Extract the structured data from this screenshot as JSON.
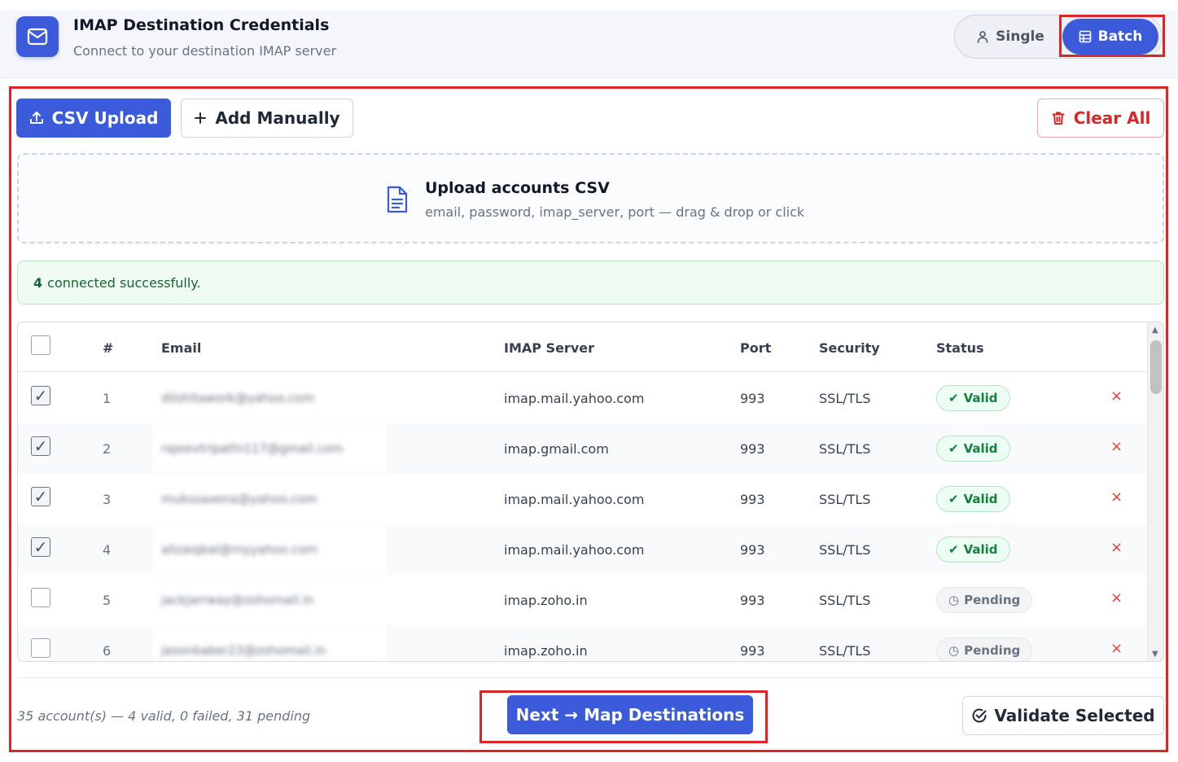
{
  "header": {
    "title": "IMAP Destination Credentials",
    "subtitle": "Connect to your destination IMAP server",
    "mode_single": "Single",
    "mode_batch": "Batch"
  },
  "toolbar": {
    "csv_upload": "CSV Upload",
    "add_manually": "Add Manually",
    "clear_all": "Clear All"
  },
  "dropzone": {
    "title": "Upload accounts CSV",
    "subtitle": "email, password, imap_server, port — drag & drop or click"
  },
  "success": {
    "count": "4",
    "message": "connected successfully."
  },
  "table": {
    "headers": {
      "num": "#",
      "email": "Email",
      "server": "IMAP Server",
      "port": "Port",
      "security": "Security",
      "status": "Status"
    },
    "rows": [
      {
        "num": "1",
        "email": "dilshitawork@yahoo.com",
        "server": "imap.mail.yahoo.com",
        "port": "993",
        "security": "SSL/TLS",
        "status": "Valid",
        "checked": true
      },
      {
        "num": "2",
        "email": "rajeevtripathi117@gmail.com",
        "server": "imap.gmail.com",
        "port": "993",
        "security": "SSL/TLS",
        "status": "Valid",
        "checked": true
      },
      {
        "num": "3",
        "email": "mukssaxena@yahoo.com",
        "server": "imap.mail.yahoo.com",
        "port": "993",
        "security": "SSL/TLS",
        "status": "Valid",
        "checked": true
      },
      {
        "num": "4",
        "email": "alizaiqbal@myyahoo.com",
        "server": "imap.mail.yahoo.com",
        "port": "993",
        "security": "SSL/TLS",
        "status": "Valid",
        "checked": true
      },
      {
        "num": "5",
        "email": "jackjarrway@zohomail.in",
        "server": "imap.zoho.in",
        "port": "993",
        "security": "SSL/TLS",
        "status": "Pending",
        "checked": false
      },
      {
        "num": "6",
        "email": "jasonbaker23@zohomail.in",
        "server": "imap.zoho.in",
        "port": "993",
        "security": "SSL/TLS",
        "status": "Pending",
        "checked": false
      }
    ]
  },
  "footer": {
    "summary": "35 account(s) — 4 valid, 0 failed, 31 pending",
    "next": "Next → Map Destinations",
    "validate": "Validate Selected"
  },
  "icons": {
    "valid": "✔",
    "pending": "◷",
    "remove": "×",
    "check": "✓"
  },
  "colors": {
    "accent": "#3b5bdb",
    "danger": "#dc2626",
    "success": "#15803d"
  }
}
